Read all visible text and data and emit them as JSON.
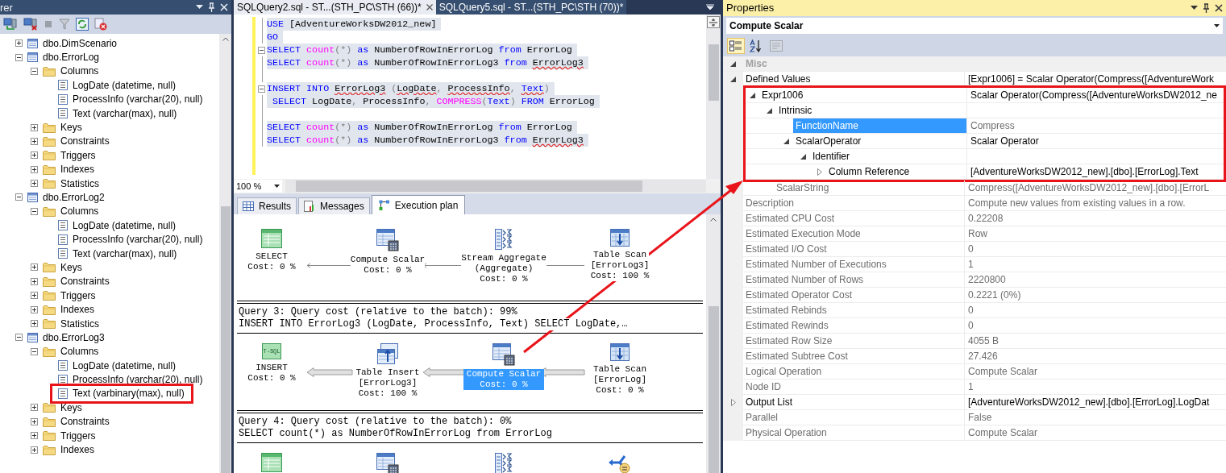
{
  "explorer": {
    "title": "rer",
    "tree": [
      {
        "label": "dbo.DimScenario",
        "kind": "table",
        "expanded": false
      },
      {
        "label": "dbo.ErrorLog",
        "kind": "table",
        "expanded": true,
        "children": [
          {
            "label": "Columns",
            "kind": "folder",
            "expanded": true,
            "children": [
              {
                "label": "LogDate (datetime, null)",
                "kind": "column"
              },
              {
                "label": "ProcessInfo (varchar(20), null)",
                "kind": "column"
              },
              {
                "label": "Text (varchar(max), null)",
                "kind": "column"
              }
            ]
          },
          {
            "label": "Keys",
            "kind": "folder",
            "expanded": false
          },
          {
            "label": "Constraints",
            "kind": "folder",
            "expanded": false
          },
          {
            "label": "Triggers",
            "kind": "folder",
            "expanded": false
          },
          {
            "label": "Indexes",
            "kind": "folder",
            "expanded": false
          },
          {
            "label": "Statistics",
            "kind": "folder",
            "expanded": false
          }
        ]
      },
      {
        "label": "dbo.ErrorLog2",
        "kind": "table",
        "expanded": true,
        "children": [
          {
            "label": "Columns",
            "kind": "folder",
            "expanded": true,
            "children": [
              {
                "label": "LogDate (datetime, null)",
                "kind": "column"
              },
              {
                "label": "ProcessInfo (varchar(20), null)",
                "kind": "column"
              },
              {
                "label": "Text (varchar(max), null)",
                "kind": "column"
              }
            ]
          },
          {
            "label": "Keys",
            "kind": "folder",
            "expanded": false
          },
          {
            "label": "Constraints",
            "kind": "folder",
            "expanded": false
          },
          {
            "label": "Triggers",
            "kind": "folder",
            "expanded": false
          },
          {
            "label": "Indexes",
            "kind": "folder",
            "expanded": false
          },
          {
            "label": "Statistics",
            "kind": "folder",
            "expanded": false
          }
        ]
      },
      {
        "label": "dbo.ErrorLog3",
        "kind": "table",
        "expanded": true,
        "children": [
          {
            "label": "Columns",
            "kind": "folder",
            "expanded": true,
            "children": [
              {
                "label": "LogDate (datetime, null)",
                "kind": "column"
              },
              {
                "label": "ProcessInfo (varchar(20), null)",
                "kind": "column"
              },
              {
                "label": "Text (varbinary(max), null)",
                "kind": "column",
                "annotated": true
              }
            ]
          },
          {
            "label": "Keys",
            "kind": "folder",
            "expanded": false
          },
          {
            "label": "Constraints",
            "kind": "folder",
            "expanded": false
          },
          {
            "label": "Triggers",
            "kind": "folder",
            "expanded": false
          },
          {
            "label": "Indexes",
            "kind": "folder",
            "expanded": false
          }
        ]
      }
    ]
  },
  "doc_tabs": [
    {
      "label": "SQLQuery2.sql - ST...(STH_PC\\STH (66))*",
      "selected": true
    },
    {
      "label": "SQLQuery5.sql - ST...(STH_PC\\STH (70))*",
      "selected": false
    }
  ],
  "editor": {
    "zoom": "100 %",
    "lines": [
      {
        "fold": false,
        "tokens": [
          {
            "text": "USE",
            "kind": "kw"
          },
          {
            "text": " [AdventureWorksDW2012_new]",
            "kind": "id"
          }
        ]
      },
      {
        "fold": false,
        "tokens": [
          {
            "text": "GO",
            "kind": "kw"
          }
        ]
      },
      {
        "fold": true,
        "tokens": [
          {
            "text": "SELECT ",
            "kind": "kw"
          },
          {
            "text": "count",
            "kind": "fn"
          },
          {
            "text": "(*) ",
            "kind": "op"
          },
          {
            "text": "as",
            "kind": "kw"
          },
          {
            "text": " NumberOfRowInErrorLog ",
            "kind": "id"
          },
          {
            "text": "from",
            "kind": "kw"
          },
          {
            "text": " ErrorLog",
            "kind": "id"
          }
        ]
      },
      {
        "fold": false,
        "tokens": [
          {
            "text": "SELECT ",
            "kind": "kw"
          },
          {
            "text": "count",
            "kind": "fn"
          },
          {
            "text": "(*) ",
            "kind": "op"
          },
          {
            "text": "as",
            "kind": "kw"
          },
          {
            "text": " NumberOfRowInErrorLog3 ",
            "kind": "id"
          },
          {
            "text": "from ",
            "kind": "kw"
          },
          {
            "text": "ErrorLog3",
            "kind": "err"
          }
        ]
      },
      {
        "fold": false
      },
      {
        "fold": true,
        "tokens": [
          {
            "text": "INSERT INTO ",
            "kind": "kw"
          },
          {
            "text": "ErrorLog3",
            "kind": "err"
          },
          {
            "text": " (",
            "kind": "op"
          },
          {
            "text": "LogDate",
            "kind": "err"
          },
          {
            "text": ", ",
            "kind": "op"
          },
          {
            "text": "ProcessInfo",
            "kind": "err"
          },
          {
            "text": ", ",
            "kind": "op"
          },
          {
            "text": "Text",
            "kind": "kwerr"
          },
          {
            "text": ")",
            "kind": "op"
          }
        ]
      },
      {
        "fold": false,
        "tokens": [
          {
            "text": " SELECT",
            "kind": "kw"
          },
          {
            "text": " LogDate",
            "kind": "id"
          },
          {
            "text": ", ",
            "kind": "op"
          },
          {
            "text": "ProcessInfo",
            "kind": "id"
          },
          {
            "text": ", ",
            "kind": "op"
          },
          {
            "text": "COMPRESS",
            "kind": "fn"
          },
          {
            "text": "(",
            "kind": "op"
          },
          {
            "text": "Text",
            "kind": "kw"
          },
          {
            "text": ") ",
            "kind": "op"
          },
          {
            "text": "FROM",
            "kind": "kw"
          },
          {
            "text": " ErrorLog",
            "kind": "id"
          }
        ]
      },
      {
        "fold": false
      },
      {
        "fold": false,
        "tokens": [
          {
            "text": "SELECT ",
            "kind": "kw"
          },
          {
            "text": "count",
            "kind": "fn"
          },
          {
            "text": "(*) ",
            "kind": "op"
          },
          {
            "text": "as",
            "kind": "kw"
          },
          {
            "text": " NumberOfRowInErrorLog ",
            "kind": "id"
          },
          {
            "text": "from",
            "kind": "kw"
          },
          {
            "text": " ErrorLog",
            "kind": "id"
          }
        ]
      },
      {
        "fold": false,
        "tokens": [
          {
            "text": "SELECT ",
            "kind": "kw"
          },
          {
            "text": "count",
            "kind": "fn"
          },
          {
            "text": "(*) ",
            "kind": "op"
          },
          {
            "text": "as",
            "kind": "kw"
          },
          {
            "text": " NumberOfRowInErrorLog3 ",
            "kind": "id"
          },
          {
            "text": "from ",
            "kind": "kw"
          },
          {
            "text": "ErrorLog3",
            "kind": "err"
          }
        ]
      }
    ]
  },
  "result_tabs": [
    {
      "label": "Results",
      "kind": "grid",
      "selected": false
    },
    {
      "label": "Messages",
      "kind": "messages",
      "selected": false
    },
    {
      "label": "Execution plan",
      "kind": "plan",
      "selected": true
    }
  ],
  "plan": {
    "queries": [
      {
        "kind": "thin",
        "nodes": [
          {
            "kind": "select",
            "lines": [
              "SELECT",
              "Cost: 0 %"
            ],
            "selected": false
          },
          {
            "kind": "compute",
            "lines": [
              "Compute Scalar",
              "Cost: 0 %"
            ],
            "selected": false
          },
          {
            "kind": "aggregate",
            "lines": [
              "Stream Aggregate",
              "(Aggregate)",
              "Cost: 0 %"
            ],
            "selected": false
          },
          {
            "kind": "scan",
            "lines": [
              "Table Scan",
              "[ErrorLog3]",
              "Cost: 100 %"
            ],
            "selected": false
          }
        ]
      },
      {
        "header": [
          "Query 3: Query cost (relative to the batch): 99%",
          "INSERT INTO ErrorLog3 (LogDate, ProcessInfo, Text) SELECT LogDate,…"
        ],
        "kind": "thick",
        "nodes": [
          {
            "kind": "tsql",
            "badge": "T-SQL",
            "lines": [
              "INSERT",
              "Cost: 0 %"
            ],
            "selected": false
          },
          {
            "kind": "insert",
            "lines": [
              "Table Insert",
              "[ErrorLog3]",
              "Cost: 100 %"
            ],
            "selected": false
          },
          {
            "kind": "compute",
            "lines": [
              "Compute Scalar",
              "Cost: 0 %"
            ],
            "selected": true
          },
          {
            "kind": "scan",
            "lines": [
              "Table Scan",
              "[ErrorLog]",
              "Cost: 0 %"
            ],
            "selected": false
          }
        ]
      },
      {
        "header": [
          "Query 4: Query cost (relative to the batch): 0%",
          "SELECT count(*) as NumberOfRowInErrorLog from ErrorLog"
        ],
        "nodes": [
          {
            "kind": "select"
          },
          {
            "kind": "compute"
          },
          {
            "kind": "aggregate"
          },
          {
            "kind": "parallelism"
          }
        ]
      }
    ]
  },
  "properties": {
    "title": "Properties",
    "object": "Compute Scalar",
    "toolbar": [
      {
        "kind": "categorized",
        "selected": true,
        "disabled": false
      },
      {
        "kind": "alphabetical",
        "selected": false,
        "disabled": false
      },
      {
        "kind": "pages",
        "selected": false,
        "disabled": true
      }
    ],
    "categories": [
      {
        "label": "Misc",
        "expanded": true,
        "rows": [
          {
            "name": "Defined Values",
            "value": "[Expr1006] = Scalar Operator(Compress([AdventureWork",
            "readonly": false,
            "selected": false,
            "expanded": true,
            "children": [
              {
                "name": "Expr1006",
                "value": "Scalar Operator(Compress([AdventureWorksDW2012_ne",
                "readonly": false,
                "selected": false,
                "annotated": true,
                "expanded": true,
                "children": [
                  {
                    "name": "Intrinsic",
                    "selected": false,
                    "annotated": true,
                    "expanded": true,
                    "children": [
                      {
                        "name": "FunctionName",
                        "value": "Compress",
                        "readonly": true,
                        "selected": true,
                        "annotated": true
                      },
                      {
                        "name": "ScalarOperator",
                        "value": "Scalar Operator",
                        "readonly": false,
                        "selected": false,
                        "annotated": true,
                        "expanded": true,
                        "children": [
                          {
                            "name": "Identifier",
                            "selected": false,
                            "annotated": true,
                            "expanded": true,
                            "children": [
                              {
                                "name": "Column Reference",
                                "value": "[AdventureWorksDW2012_new].[dbo].[ErrorLog].Text",
                                "readonly": false,
                                "selected": false,
                                "annotated": true,
                                "expanded": false
                              }
                            ]
                          }
                        ]
                      }
                    ]
                  },
                  {
                    "name": "ScalarString",
                    "value": "Compress([AdventureWorksDW2012_new].[dbo].[ErrorL",
                    "readonly": true,
                    "selected": false
                  }
                ]
              }
            ]
          },
          {
            "name": "Description",
            "value": "Compute new values from existing values in a row.",
            "readonly": true,
            "selected": false
          },
          {
            "name": "Estimated CPU Cost",
            "value": "0.22208",
            "readonly": true,
            "selected": false
          },
          {
            "name": "Estimated Execution Mode",
            "value": "Row",
            "readonly": true,
            "selected": false
          },
          {
            "name": "Estimated I/O Cost",
            "value": "0",
            "readonly": true,
            "selected": false
          },
          {
            "name": "Estimated Number of Executions",
            "value": "1",
            "readonly": true,
            "selected": false
          },
          {
            "name": "Estimated Number of Rows",
            "value": "2220800",
            "readonly": true,
            "selected": false
          },
          {
            "name": "Estimated Operator Cost",
            "value": "0.2221 (0%)",
            "readonly": true,
            "selected": false
          },
          {
            "name": "Estimated Rebinds",
            "value": "0",
            "readonly": true,
            "selected": false
          },
          {
            "name": "Estimated Rewinds",
            "value": "0",
            "readonly": true,
            "selected": false
          },
          {
            "name": "Estimated Row Size",
            "value": "4055 B",
            "readonly": true,
            "selected": false
          },
          {
            "name": "Estimated Subtree Cost",
            "value": "27.426",
            "readonly": true,
            "selected": false
          },
          {
            "name": "Logical Operation",
            "value": "Compute Scalar",
            "readonly": true,
            "selected": false
          },
          {
            "name": "Node ID",
            "value": "1",
            "readonly": true,
            "selected": false
          },
          {
            "name": "Output List",
            "value": "[AdventureWorksDW2012_new].[dbo].[ErrorLog].LogDat",
            "readonly": false,
            "selected": false,
            "expanded": false
          },
          {
            "name": "Parallel",
            "value": "False",
            "readonly": true,
            "selected": false
          },
          {
            "name": "Physical Operation",
            "value": "Compute Scalar",
            "readonly": true,
            "selected": false
          }
        ]
      }
    ]
  }
}
